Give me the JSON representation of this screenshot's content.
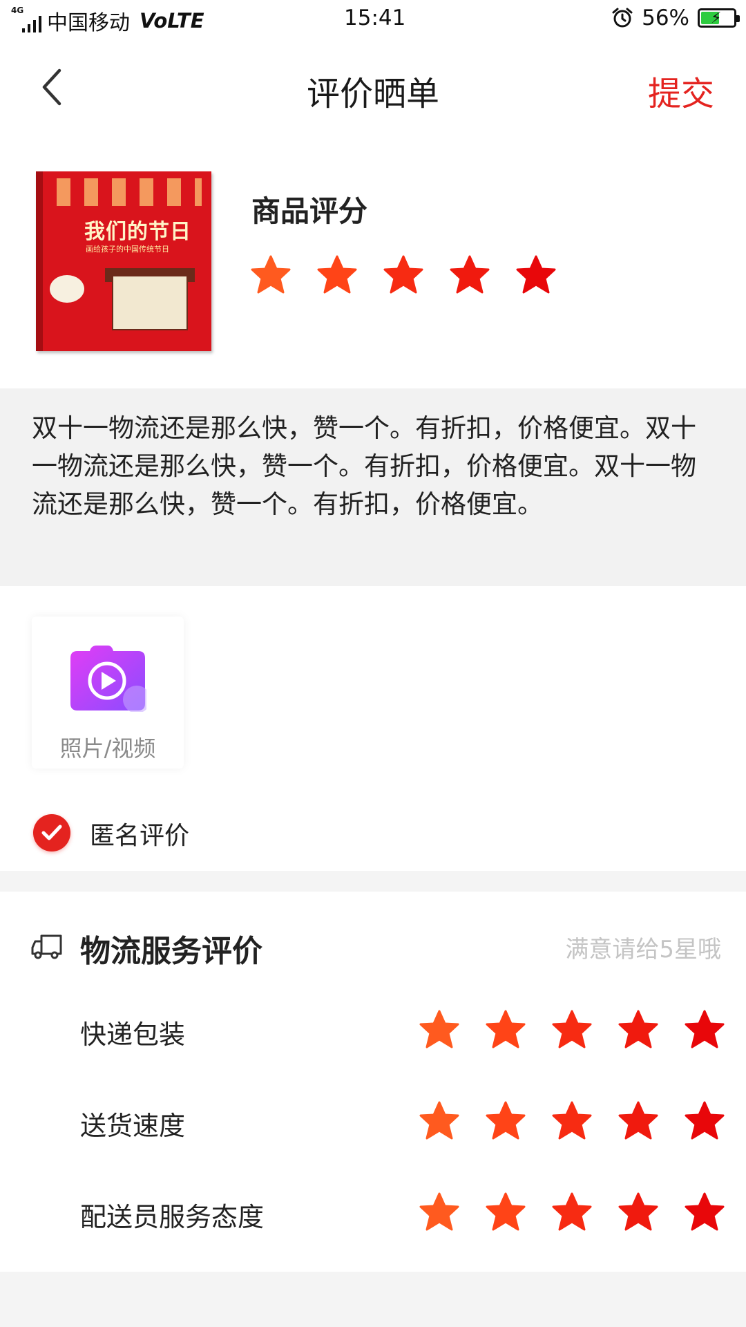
{
  "status_bar": {
    "network": "4G",
    "carrier": "中国移动",
    "volte": "VoLTE",
    "time": "15:41",
    "battery_percent": "56%",
    "battery_level": 0.56
  },
  "nav": {
    "title": "评价晒单",
    "submit_label": "提交",
    "back_icon": "chevron-left-icon"
  },
  "product": {
    "cover_title": "我们的节日",
    "cover_subtitle": "画给孩子的中国传统节日",
    "rating_title": "商品评分",
    "rating": 5,
    "max_rating": 5
  },
  "review": {
    "text": "双十一物流还是那么快，赞一个。有折扣，价格便宜。双十一物流还是那么快，赞一个。有折扣，价格便宜。双十一物流还是那么快，赞一个。有折扣，价格便宜。"
  },
  "media": {
    "upload_label": "照片/视频",
    "upload_icon": "camera-play-icon"
  },
  "anonymous": {
    "label": "匿名评价",
    "checked": true
  },
  "logistics": {
    "title": "物流服务评价",
    "hint": "满意请给5星哦",
    "icon": "truck-icon",
    "items": [
      {
        "label": "快递包装",
        "rating": 5
      },
      {
        "label": "送货速度",
        "rating": 5
      },
      {
        "label": "配送员服务态度",
        "rating": 5
      }
    ]
  },
  "colors": {
    "accent": "#e4231f",
    "star_gradient": [
      "#ff5a1f",
      "#ff4417",
      "#f72b12",
      "#f01a0e",
      "#e8070a"
    ]
  }
}
